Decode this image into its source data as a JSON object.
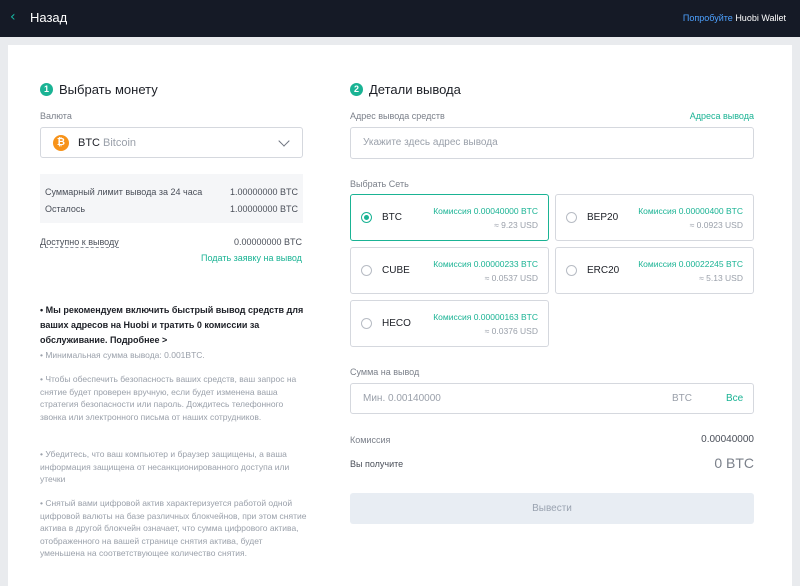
{
  "topbar": {
    "back_label": "Назад",
    "try_prefix": "Попробуйте",
    "wallet_name": "Huobi Wallet"
  },
  "step1": {
    "num": "1",
    "title": "Выбрать монету",
    "currency_label": "Валюта",
    "currency": {
      "icon": "btc-coin-icon",
      "symbol": "₿",
      "code": "BTC",
      "name": "Bitcoin"
    },
    "limit_24h_label": "Суммарный лимит вывода за 24 часа",
    "limit_24h_value": "1.00000000 BTC",
    "remaining_label": "Осталось",
    "remaining_value": "1.00000000 BTC",
    "available_label": "Доступно к выводу",
    "available_value": "0.00000000 BTC",
    "request_link": "Подать заявку на вывод"
  },
  "tips": {
    "bold": "• Мы рекомендуем включить быстрый вывод средств для ваших адресов на Huobi и тратить 0 комиссии за обслуживание. Подробнее >",
    "items": [
      "• Минимальная сумма вывода: 0.001BTC.",
      "• Чтобы обеспечить безопасность ваших средств, ваш запрос на снятие будет проверен вручную, если будет изменена ваша стратегия безопасности или пароль. Дождитесь телефонного звонка или электронного письма от наших сотрудников.",
      "• Убедитесь, что ваш компьютер и браузер защищены, а ваша информация защищена от несанкционированного доступа или утечки",
      "• Снятый вами цифровой актив характеризуется работой одной цифровой валюты на базе различных блокчейнов, при этом снятие актива в другой блокчейн означает, что сумма цифрового актива, отображенного на вашей странице снятия актива, будет уменьшена на соответствующее количество снятия."
    ]
  },
  "step2": {
    "num": "2",
    "title": "Детали вывода",
    "address_label": "Адрес вывода средств",
    "address_link": "Адреса вывода",
    "address_placeholder": "Укажите здесь адрес вывода",
    "network_label": "Выбрать Сеть",
    "networks": [
      {
        "name": "BTC",
        "fee": "Комиссия 0.00040000 BTC",
        "usd": "≈ 9.23 USD",
        "selected": true
      },
      {
        "name": "BEP20",
        "fee": "Комиссия 0.00000400 BTC",
        "usd": "≈ 0.0923 USD",
        "selected": false
      },
      {
        "name": "CUBE",
        "fee": "Комиссия 0.00000233 BTC",
        "usd": "≈ 0.0537 USD",
        "selected": false
      },
      {
        "name": "ERC20",
        "fee": "Комиссия 0.00022245 BTC",
        "usd": "≈ 5.13 USD",
        "selected": false
      },
      {
        "name": "HECO",
        "fee": "Комиссия 0.00000163 BTC",
        "usd": "≈ 0.0376 USD",
        "selected": false
      }
    ],
    "amount_label": "Сумма на вывод",
    "amount_placeholder": "Мин. 0.00140000",
    "amount_unit": "BTC",
    "amount_all": "Все",
    "fee_label": "Комиссия",
    "fee_value": "0.00040000",
    "receive_label": "Вы получите",
    "receive_value": "0 BTC",
    "withdraw_button": "Вывести"
  },
  "colors": {
    "accent": "#1ab394",
    "topbar": "#151a26",
    "btc": "#f7931a",
    "link_blue": "#4da1ff"
  }
}
